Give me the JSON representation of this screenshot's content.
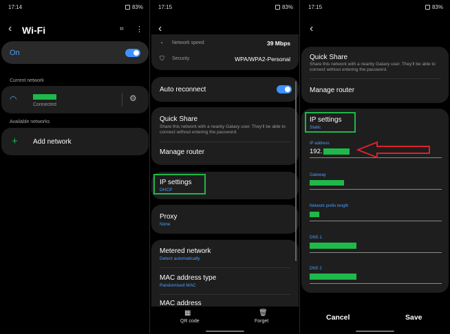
{
  "screen1": {
    "time": "17:14",
    "battery": "83%",
    "title": "Wi-Fi",
    "toggle_label": "On",
    "current_network_header": "Current network",
    "connected_label": "Connected",
    "available_networks_header": "Available networks",
    "add_network_label": "Add network"
  },
  "screen2": {
    "time": "17:15",
    "battery": "83%",
    "network_speed_label": "Network speed",
    "network_speed_value": "39 Mbps",
    "security_label": "Security",
    "security_value": "WPA/WPA2-Personal",
    "auto_reconnect_label": "Auto reconnect",
    "quick_share_title": "Quick Share",
    "quick_share_desc": "Share this network with a nearby Galaxy user. They'll be able to connect without entering the password.",
    "manage_router_label": "Manage router",
    "ip_settings_label": "IP settings",
    "ip_settings_value": "DHCP",
    "proxy_label": "Proxy",
    "proxy_value": "None",
    "metered_label": "Metered network",
    "metered_value": "Detect automatically",
    "mac_type_label": "MAC address type",
    "mac_type_value": "Randomised MAC",
    "mac_address_label": "MAC address",
    "qr_code_label": "QR code",
    "forget_label": "Forget"
  },
  "screen3": {
    "time": "17:15",
    "battery": "83%",
    "quick_share_title": "Quick Share",
    "quick_share_desc": "Share this network with a nearby Galaxy user. They'll be able to connect without entering the password.",
    "manage_router_label": "Manage router",
    "ip_settings_label": "IP settings",
    "ip_settings_value": "Static",
    "ip_address_label": "IP address",
    "ip_address_prefix": "192.",
    "gateway_label": "Gateway",
    "prefix_length_label": "Network prefix length",
    "dns1_label": "DNS 1",
    "dns2_label": "DNS 2",
    "cancel_label": "Cancel",
    "save_label": "Save"
  },
  "colors": {
    "accent_blue": "#3e91ff",
    "highlight_green": "#1fb84a",
    "annotation_red": "#e0202a",
    "card_bg": "#1e1e1e"
  }
}
